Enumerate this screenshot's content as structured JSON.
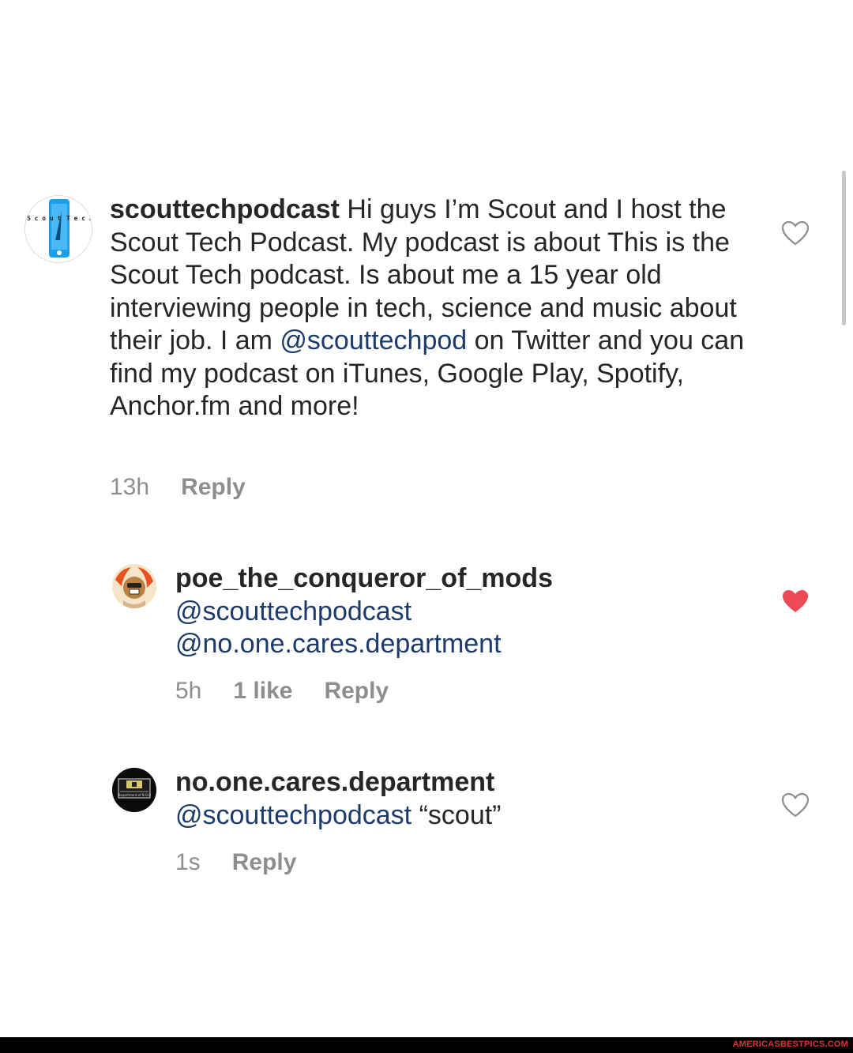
{
  "comments": [
    {
      "username": "scouttechpodcast",
      "body_before": " Hi guys I’m Scout and I host the Scout Tech Podcast. My podcast is about This is the Scout Tech podcast. Is about me a 15 year old interviewing people in tech, science and music about their job. I am ",
      "mention": "@scouttechpod",
      "body_after": " on Twitter and you can find my podcast on iTunes, Google Play, Spotify, Anchor.fm and more!",
      "time": "13h",
      "reply": "Reply",
      "liked": false,
      "avatar_text": "Scout Tech"
    },
    {
      "username": "poe_the_conqueror_of_mods",
      "mention1": "@scouttechpodcast",
      "mention2": "@no.one.cares.department",
      "time": "5h",
      "likes": "1 like",
      "reply": "Reply",
      "liked": true
    },
    {
      "username": "no.one.cares.department",
      "mention": "@scouttechpodcast",
      "quote": " “scout”",
      "time": "1s",
      "reply": "Reply",
      "liked": false,
      "avatar_text": "Department of N.O.C"
    }
  ],
  "colors": {
    "mention": "#1c3b6b",
    "meta": "#8e8e8e",
    "like_red": "#ed4956"
  },
  "footer": {
    "watermark": "AMERICASBESTPICS.COM"
  }
}
